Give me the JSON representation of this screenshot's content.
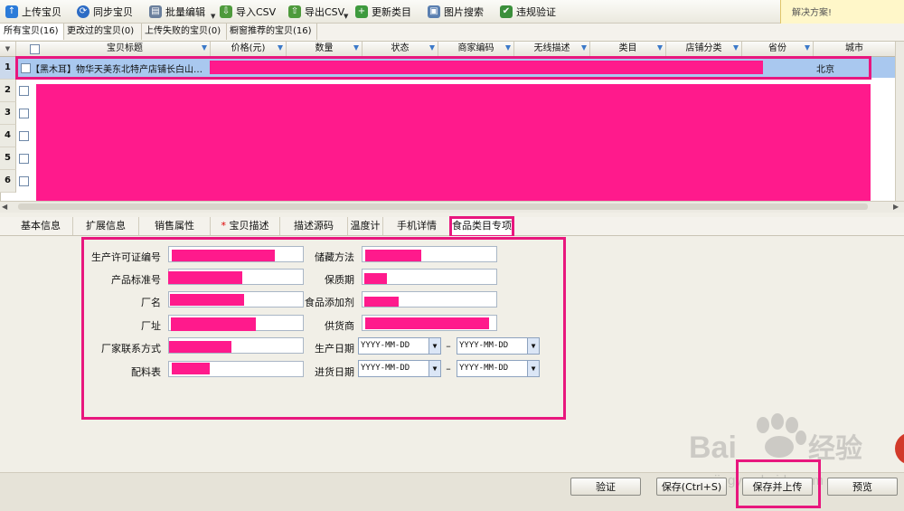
{
  "toolbar": {
    "upload": "上传宝贝",
    "sync": "同步宝贝",
    "batch_edit": "批量编辑",
    "import_csv": "导入CSV",
    "export_csv": "导出CSV",
    "update_category": "更新类目",
    "image_search": "图片搜索",
    "violation_check": "违规验证"
  },
  "tip": {
    "text": "解决方案!"
  },
  "tabs": [
    {
      "label": "所有宝贝(16)"
    },
    {
      "label": "更改过的宝贝(0)"
    },
    {
      "label": "上传失败的宝贝(0)"
    },
    {
      "label": "橱窗推荐的宝贝(16)"
    }
  ],
  "grid": {
    "columns": [
      "宝贝标题",
      "价格(元)",
      "数量",
      "状态",
      "商家编码",
      "无线描述",
      "类目",
      "店铺分类",
      "省份",
      "城市"
    ],
    "rows": [
      {
        "num": "1",
        "title": "【黑木耳】物华天美东北特产店铺长白山…",
        "city": "北京"
      },
      {
        "num": "2"
      },
      {
        "num": "3"
      },
      {
        "num": "4"
      },
      {
        "num": "5"
      },
      {
        "num": "6"
      }
    ]
  },
  "detail_tabs": [
    "基本信息",
    "扩展信息",
    "销售属性",
    "宝贝描述",
    "描述源码",
    "温度计",
    "手机详情",
    "食品类目专项"
  ],
  "required_mark": "*",
  "form": {
    "license_label": "生产许可证编号",
    "standard_label": "产品标准号",
    "factory_label": "厂名",
    "address_label": "厂址",
    "contact_label": "厂家联系方式",
    "ingredients_label": "配料表",
    "storage_label": "储藏方法",
    "shelf_label": "保质期",
    "additive_label": "食品添加剂",
    "supplier_label": "供货商",
    "prod_date_label": "生产日期",
    "stock_date_label": "进货日期",
    "date_placeholder": "YYYY-MM-DD",
    "range_sep": "–"
  },
  "buttons": {
    "verify": "验证",
    "save": "保存(Ctrl+S)",
    "save_upload": "保存并上传",
    "preview": "预览"
  },
  "watermark": {
    "brand": "Bai",
    "brand2": "经验",
    "url": "jingyan.baidu.com"
  },
  "colors": {
    "highlight": "#e8177e",
    "redaction": "#ff1a8c",
    "selection": "#a9c8ef"
  }
}
